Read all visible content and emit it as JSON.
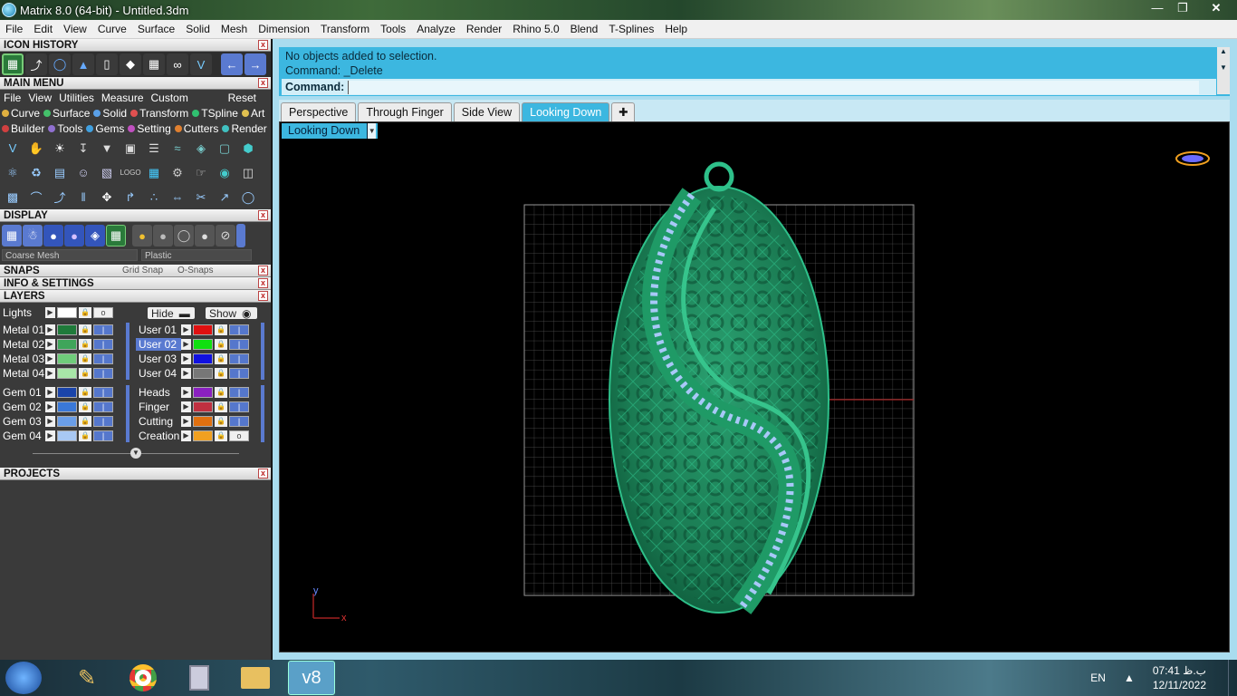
{
  "window": {
    "title": "Matrix 8.0 (64-bit) - Untitled.3dm"
  },
  "menubar": [
    "File",
    "Edit",
    "View",
    "Curve",
    "Surface",
    "Solid",
    "Mesh",
    "Dimension",
    "Transform",
    "Tools",
    "Analyze",
    "Render",
    "Rhino 5.0",
    "Blend",
    "T-Splines",
    "Help"
  ],
  "panels": {
    "icon_history": "ICON HISTORY",
    "main_menu": "MAIN MENU",
    "display": "DISPLAY",
    "snaps": "SNAPS",
    "info": "INFO & SETTINGS",
    "layers": "LAYERS",
    "projects": "PROJECTS"
  },
  "main_menu_items": [
    "File",
    "View",
    "Utilities",
    "Measure",
    "Custom"
  ],
  "main_menu_reset": "Reset",
  "categories_row1": [
    {
      "label": "Curve",
      "color": "#e0b040"
    },
    {
      "label": "Surface",
      "color": "#44c06a"
    },
    {
      "label": "Solid",
      "color": "#5aa0e8"
    },
    {
      "label": "Transform",
      "color": "#e05050"
    },
    {
      "label": "TSpline",
      "color": "#30c070"
    },
    {
      "label": "Art",
      "color": "#e0c050"
    }
  ],
  "categories_row2": [
    {
      "label": "Builder",
      "color": "#d04040"
    },
    {
      "label": "Tools",
      "color": "#9070d0"
    },
    {
      "label": "Gems",
      "color": "#40a0e0"
    },
    {
      "label": "Setting",
      "color": "#c050c0"
    },
    {
      "label": "Cutters",
      "color": "#e08030"
    },
    {
      "label": "Render",
      "color": "#40c0c0"
    }
  ],
  "display": {
    "mesh_option": "Coarse Mesh",
    "material_option": "Plastic"
  },
  "snaps": {
    "grid_snap": "Grid Snap",
    "osnaps": "O-Snaps"
  },
  "layers": {
    "lights": "Lights",
    "hide": "Hide",
    "show": "Show",
    "left": [
      {
        "name": "Metal 01",
        "color": "#1f7a3a"
      },
      {
        "name": "Metal 02",
        "color": "#3fa55a"
      },
      {
        "name": "Metal 03",
        "color": "#6fcc7a"
      },
      {
        "name": "Metal 04",
        "color": "#a8e6a8"
      },
      {
        "name": "Gem 01",
        "color": "#1a44aa"
      },
      {
        "name": "Gem 02",
        "color": "#3a78d8"
      },
      {
        "name": "Gem 03",
        "color": "#6a9ee8"
      },
      {
        "name": "Gem 04",
        "color": "#a8c8f4"
      }
    ],
    "right": [
      {
        "name": "User 01",
        "color": "#e01010"
      },
      {
        "name": "User 02",
        "color": "#10e010"
      },
      {
        "name": "User 03",
        "color": "#1010e0"
      },
      {
        "name": "User 04",
        "color": "#777777"
      },
      {
        "name": "Heads",
        "color": "#8a20c0"
      },
      {
        "name": "Finger",
        "color": "#c03040"
      },
      {
        "name": "Cutting",
        "color": "#e07010"
      },
      {
        "name": "Creation",
        "color": "#f0a020"
      }
    ]
  },
  "command": {
    "history_line1": "No objects added to selection.",
    "history_line2": "Command: _Delete",
    "prompt": "Command:"
  },
  "tabs": [
    "Perspective",
    "Through Finger",
    "Side View",
    "Looking Down"
  ],
  "active_view": "Looking Down",
  "axis": {
    "x": "x",
    "y": "y"
  },
  "tray": {
    "lang": "EN",
    "time": "07:41 ب.ظ",
    "date": "12/11/2022"
  },
  "taskbar_label": "v8"
}
